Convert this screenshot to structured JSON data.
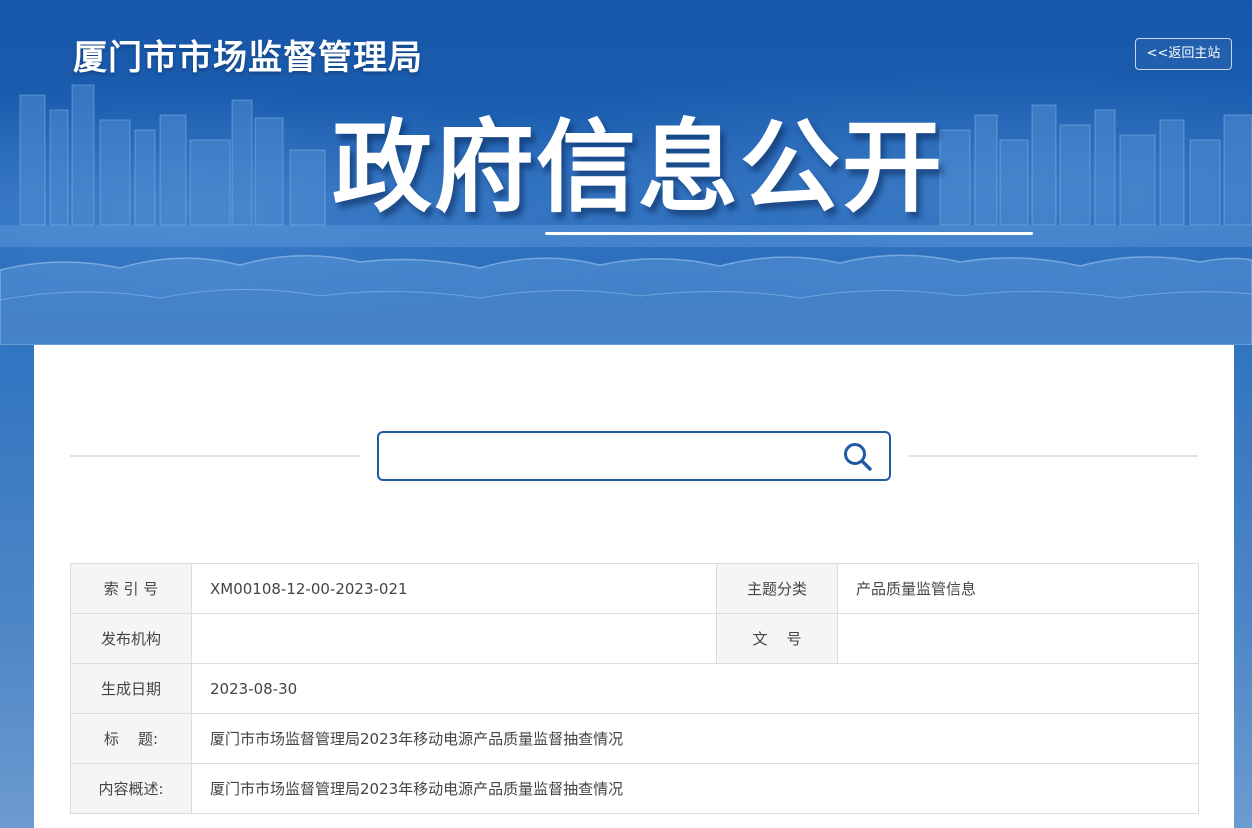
{
  "header": {
    "site_title": "厦门市市场监督管理局",
    "back_label": "<<返回主站",
    "hero_title": "政府信息公开"
  },
  "search": {
    "value": "",
    "placeholder": ""
  },
  "info": {
    "index_label": "索 引 号",
    "index_value": "XM00108-12-00-2023-021",
    "topic_label": "主题分类",
    "topic_value": "产品质量监管信息",
    "publisher_label": "发布机构",
    "publisher_value": "",
    "docno_label": "文    号",
    "docno_value": "",
    "date_label": "生成日期",
    "date_value": "2023-08-30",
    "title_label": "标    题:",
    "title_value": "厦门市市场监督管理局2023年移动电源产品质量监督抽查情况",
    "summary_label": "内容概述:",
    "summary_value": "厦门市市场监督管理局2023年移动电源产品质量监督抽查情况"
  },
  "colors": {
    "banner_blue": "#1a5cae",
    "accent_border": "#1f5aa3",
    "label_bg": "#f4f5f7"
  }
}
